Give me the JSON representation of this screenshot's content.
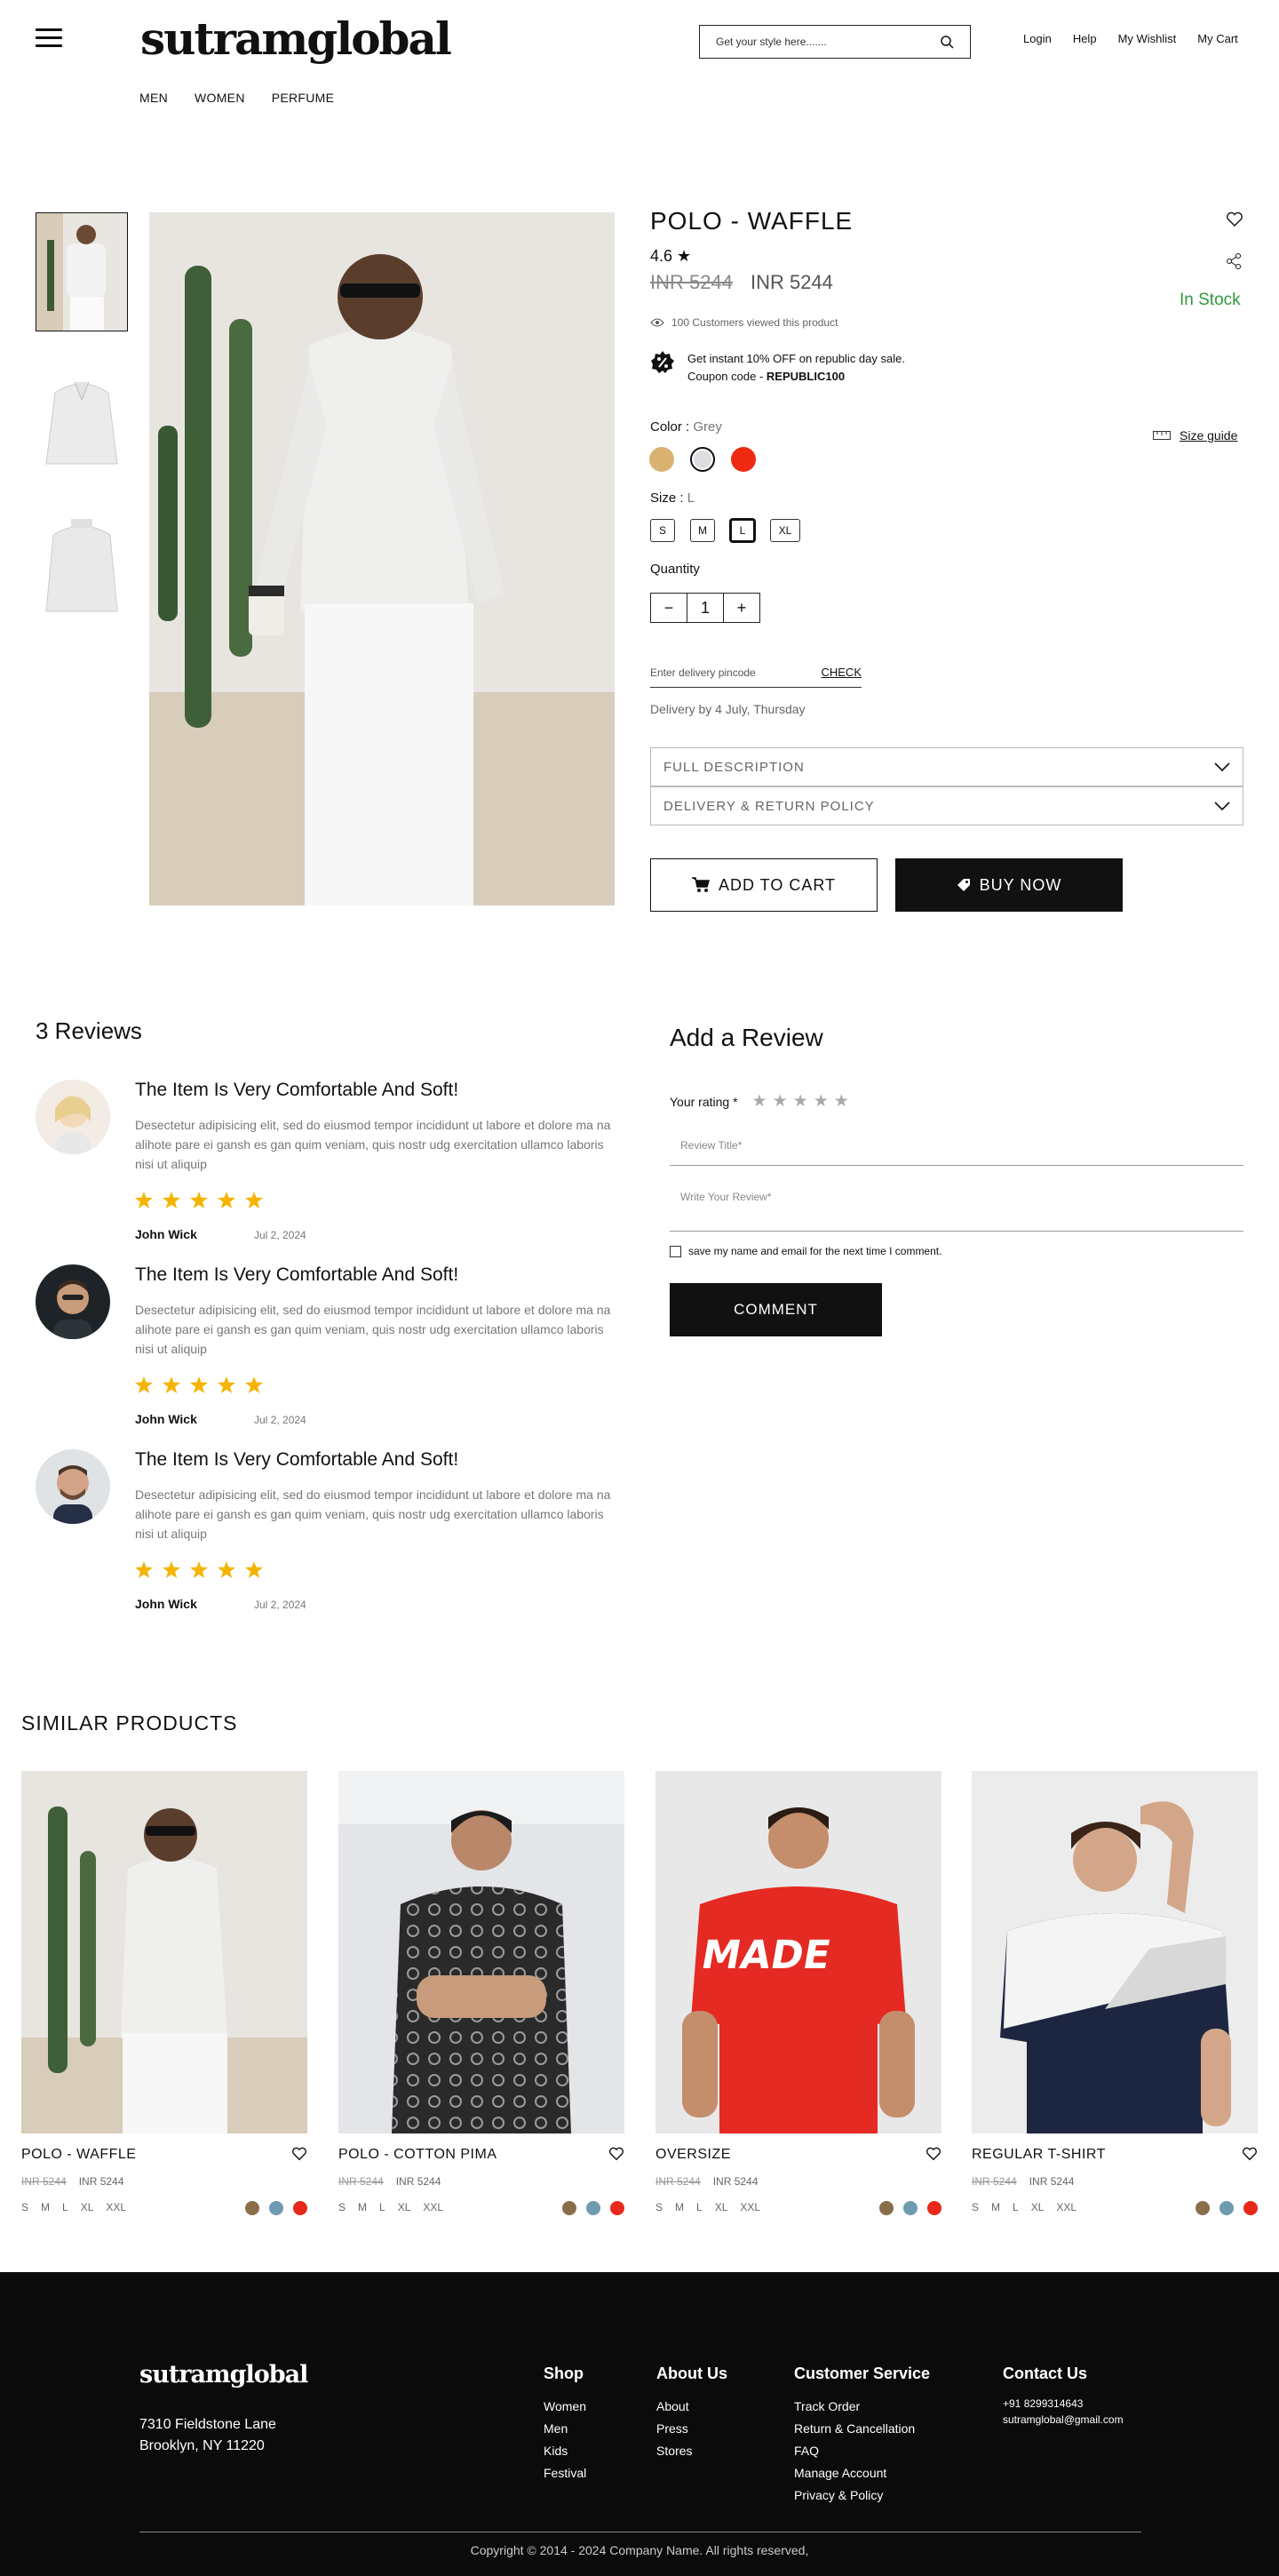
{
  "header": {
    "logo": "sutramglobal",
    "search_placeholder": "Get your style here.......",
    "links": [
      "Login",
      "Help",
      "My Wishlist",
      "My Cart"
    ],
    "categories": [
      "MEN",
      "WOMEN",
      "PERFUME"
    ]
  },
  "product": {
    "title": "POLO - WAFFLE",
    "rating": "4.6",
    "old_price": "INR 5244",
    "price": "INR 5244",
    "stock": "In Stock",
    "viewed": "100 Customers viewed this product",
    "offer_line": "Get instant 10% OFF on republic day sale.",
    "coupon_label": "Coupon code - ",
    "coupon_code": "REPUBLIC100",
    "color_label": "Color : ",
    "color_value": "Grey",
    "colors": [
      "#d9b270",
      "#e0dde2",
      "#ee2b12"
    ],
    "size_guide": "Size guide",
    "size_label": "Size : ",
    "size_value": "L",
    "sizes": [
      "S",
      "M",
      "L",
      "XL"
    ],
    "quantity_label": "Quantity",
    "quantity": "1",
    "pincode_placeholder": "Enter delivery pincode",
    "check": "CHECK",
    "delivery": "Delivery by 4  July, Thursday",
    "accordions": [
      "FULL DESCRIPTION",
      "DELIVERY & RETURN POLICY"
    ],
    "add_to_cart": "ADD TO CART",
    "buy_now": "BUY NOW"
  },
  "reviews": {
    "title": "3 Reviews",
    "items": [
      {
        "heading": "The Item Is Very Comfortable And Soft!",
        "body": "Desectetur adipisicing elit, sed do eiusmod tempor incididunt ut labore et dolore ma na alihote pare ei gansh es gan quim veniam, quis nostr udg exercitation ullamco laboris nisi ut aliquip",
        "stars": 5,
        "author": "John Wick",
        "date": "Jul 2, 2024"
      },
      {
        "heading": "The Item Is Very Comfortable And Soft!",
        "body": "Desectetur adipisicing elit, sed do eiusmod tempor incididunt ut labore et dolore ma na alihote pare ei gansh es gan quim veniam, quis nostr udg exercitation ullamco laboris nisi ut aliquip",
        "stars": 5,
        "author": "John Wick",
        "date": "Jul 2, 2024"
      },
      {
        "heading": "The Item Is Very Comfortable And Soft!",
        "body": "Desectetur adipisicing elit, sed do eiusmod tempor incididunt ut labore et dolore ma na alihote pare ei gansh es gan quim veniam, quis nostr udg exercitation ullamco laboris nisi ut aliquip",
        "stars": 5,
        "author": "John Wick",
        "date": "Jul 2, 2024"
      }
    ]
  },
  "add_review": {
    "title": "Add a Review",
    "rating_label": "Your rating *",
    "title_placeholder": "Review Title*",
    "body_placeholder": "Write Your Review*",
    "save_label": "save my name and email for the next time I comment.",
    "button": "COMMENT"
  },
  "similar": {
    "title": "SIMILAR PRODUCTS",
    "items": [
      {
        "name": "POLO - WAFFLE",
        "old": "INR 5244",
        "price": "INR 5244"
      },
      {
        "name": "POLO - COTTON PIMA",
        "old": "INR 5244",
        "price": "INR 5244"
      },
      {
        "name": "OVERSIZE",
        "old": "INR 5244",
        "price": "INR 5244"
      },
      {
        "name": "REGULAR T-SHIRT",
        "old": "INR 5244",
        "price": "INR 5244"
      }
    ],
    "sizes": [
      "S",
      "M",
      "L",
      "XL",
      "XXL"
    ],
    "dot_colors": [
      "#8a6d4a",
      "#6f9bb0",
      "#e8281a"
    ],
    "tee_print": "MADE"
  },
  "footer": {
    "logo": "sutramglobal",
    "address_1": "7310 Fieldstone Lane",
    "address_2": "Brooklyn, NY 11220",
    "shop": {
      "title": "Shop",
      "links": [
        "Women",
        "Men",
        "Kids",
        "Festival"
      ]
    },
    "about": {
      "title": "About Us",
      "links": [
        "About",
        "Press",
        "Stores"
      ]
    },
    "service": {
      "title": "Customer Service",
      "links": [
        "Track Order",
        "Return & Cancellation",
        "FAQ",
        "Manage Account",
        "Privacy & Policy"
      ]
    },
    "contact": {
      "title": "Contact Us",
      "phone": "+91 8299314643",
      "email": "sutramglobal@gmail.com"
    },
    "copyright": "Copyright © 2014 - 2024  Company Name. All rights reserved,"
  }
}
